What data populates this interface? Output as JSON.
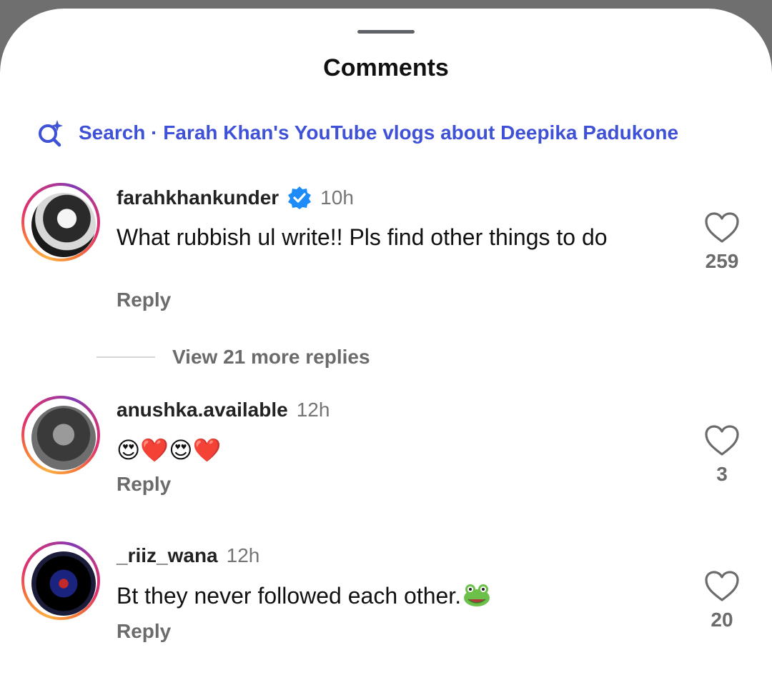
{
  "sheet": {
    "title": "Comments"
  },
  "search": {
    "icon": "sparkle-search-icon",
    "text": "Search · Farah Khan's YouTube vlogs about Deepika Padukone",
    "color": "#3f51d6"
  },
  "comments": [
    {
      "author": "farahkhankunder",
      "verified": true,
      "time": "10h",
      "text": "What rubbish ul write!! Pls find other things to do",
      "reply_label": "Reply",
      "likes": "259",
      "view_replies": "View 21 more replies"
    },
    {
      "author": "anushka.available",
      "verified": false,
      "time": "12h",
      "text": "😍❤️😍❤️",
      "reply_label": "Reply",
      "likes": "3"
    },
    {
      "author": "_riiz_wana",
      "verified": false,
      "time": "12h",
      "text": "Bt they never followed each other.",
      "text_emoji": "frog-face-icon",
      "reply_label": "Reply",
      "likes": "20"
    }
  ],
  "colors": {
    "verified_badge": "#1d8cf8",
    "muted_text": "#6b6b6b",
    "story_ring": [
      "#fcaf45",
      "#e1306c",
      "#833ab4"
    ]
  }
}
